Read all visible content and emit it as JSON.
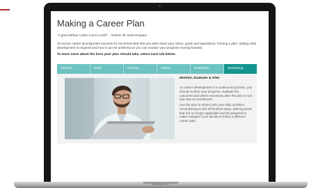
{
  "page": {
    "title": "Making a Career Plan",
    "quote": "\"A goal without a plan is just a wish\" - Antoine de Saint-Exupery",
    "intro": "To ensure career development success it's recommended that you write down your vision, goals and aspirations, forming a plan, stating what development is required and how it can be achieved so you can monitor your progress moving forward.",
    "instruction": "To learn more about the form your plan should take, select each tab below:"
  },
  "tabs": [
    {
      "label": "Options",
      "active": false
    },
    {
      "label": "Skills",
      "active": false
    },
    {
      "label": "Industry",
      "active": false
    },
    {
      "label": "Advice",
      "active": false
    },
    {
      "label": "Motivation",
      "active": false
    },
    {
      "label": "Monitoring",
      "active": true
    }
  ],
  "panel": {
    "heading": "Monitor, Evaluate & Alter",
    "paragraph1": "As career development is a continuous process, you should monitor your progress, evaluate the outcomes and where necessary alter the plan to suit any new circumstances.",
    "paragraph2": "Use the plan to inform both your daily activities remembering to tick off finished steps, altering those that are no longer applicable and be prepared to make changes if you decide to follow a different career path."
  },
  "device": {
    "label": "MacBook Pro"
  },
  "colors": {
    "tab": "#6cc3c1",
    "tab_active": "#14958f",
    "panel_bg": "#f2f2f2",
    "accent": "#b32b2b"
  }
}
